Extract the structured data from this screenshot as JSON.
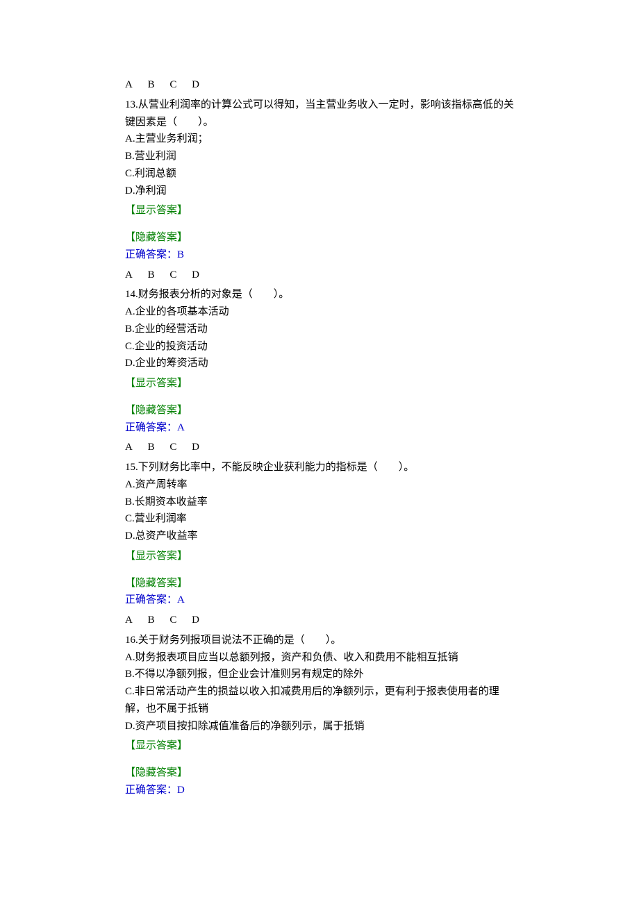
{
  "labels": {
    "show_answer_open": "【",
    "show_answer_text": "显示答案",
    "show_answer_close": "】",
    "hide_answer_open": "【",
    "hide_answer_text": "隐藏答案",
    "hide_answer_close": "】",
    "correct_prefix": "正确答案：",
    "choice_A": "A",
    "choice_B": "B",
    "choice_C": "C",
    "choice_D": "D"
  },
  "questions": [
    {
      "number": "13",
      "stem": "13.从营业利润率的计算公式可以得知，当主营业务收入一定时，影响该指标高低的关键因素是（　　）。",
      "options": [
        "A.主营业务利润；",
        "B.营业利润",
        "C.利润总额",
        "D.净利润"
      ],
      "answer": "B"
    },
    {
      "number": "14",
      "stem": "14.财务报表分析的对象是（　　）。",
      "options": [
        "A.企业的各项基本活动",
        "B.企业的经营活动",
        "C.企业的投资活动",
        "D.企业的筹资活动"
      ],
      "answer": "A"
    },
    {
      "number": "15",
      "stem": "15.下列财务比率中，不能反映企业获利能力的指标是（　　）。",
      "options": [
        "A.资产周转率",
        "B.长期资本收益率",
        "C.营业利润率",
        "D.总资产收益率"
      ],
      "answer": "A"
    },
    {
      "number": "16",
      "stem": "16.关于财务列报项目说法不正确的是（　　）。",
      "options": [
        "A.财务报表项目应当以总额列报，资产和负债、收入和费用不能相互抵销",
        "B.不得以净额列报，但企业会计准则另有规定的除外",
        "C.非日常活动产生的损益以收入扣减费用后的净额列示，更有利于报表使用者的理解，也不属于抵销",
        "D.资产项目按扣除减值准备后的净额列示，属于抵销"
      ],
      "answer": "D"
    }
  ]
}
